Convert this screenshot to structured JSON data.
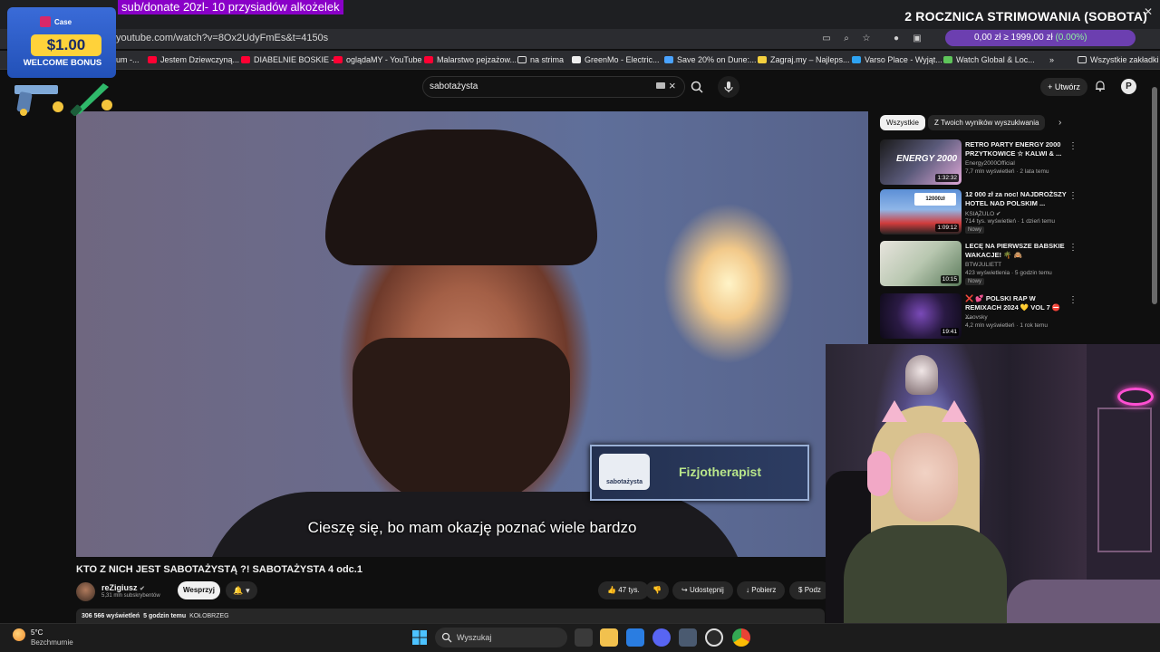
{
  "stream_overlay": {
    "top_banner": "sub/donate 20zl- 10 przysiadów alkożelek",
    "title": "2 ROCZNICA STRIMOWANIA (SOBOTA)"
  },
  "casino_ad": {
    "brand": "Case",
    "amount": "$1.00",
    "bonus": "WELCOME BONUS"
  },
  "browser": {
    "url": "youtube.com/watch?v=8Ox2UdyFmEs&t=4150s",
    "crypto": {
      "value": "0,00 zł",
      "sep": "≥",
      "target": "1999,00 zł",
      "pct": "(0.00%)"
    },
    "bookmarks": [
      {
        "label": "um -..."
      },
      {
        "label": "Jestem Dziewczyną..."
      },
      {
        "label": "DIABELNIE BOSKIE -..."
      },
      {
        "label": "oglądaMY - YouTube"
      },
      {
        "label": "Malarstwo pejzażow..."
      },
      {
        "label": "na strima"
      },
      {
        "label": "GreenMo - Electric..."
      },
      {
        "label": "Save 20% on Dune:..."
      },
      {
        "label": "Zagraj.my – Najleps..."
      },
      {
        "label": "Varso Place - Wyjąt..."
      },
      {
        "label": "Watch Global & Loc..."
      }
    ],
    "all_bookmarks": "Wszystkie zakładki"
  },
  "youtube": {
    "search_query": "sabotażysta",
    "create_label": "Utwórz",
    "video": {
      "subtitle": "Cieszę się, bo mam okazję poznać wiele bardzo",
      "lower_third_logo": "sabotażysta",
      "lower_third_name": "Fizjotherapist",
      "title": "KTO Z NICH JEST SABOTAŻYSTĄ ?! SABOTAŻYSTA 4 odc.1",
      "channel": "reZigiusz",
      "subscribers": "5,31 mln subskrybentów",
      "support_label": "Wesprzyj",
      "likes": "47 tys.",
      "share_label": "Udostępnij",
      "download_label": "Pobierz",
      "more_label": "Podz",
      "views": "306 566 wyświetleń",
      "time": "5 godzin temu",
      "location": "KOŁOBRZEG"
    },
    "chips": [
      "Wszystkie",
      "Z Twoich wyników wyszukiwania"
    ],
    "recommendations": [
      {
        "title": "RETRO PARTY ENERGY 2000 PRZYTKOWICE ☆ KALWI & ...",
        "channel": "Energy2000Official",
        "meta": "7,7 mln wyświetleń · 2 lata temu",
        "duration": "1:32:32",
        "badge": ""
      },
      {
        "title": "12 000 zł za noc! NAJDROŻSZY HOTEL NAD POLSKIM ...",
        "channel": "KSIĄŻULO ✔",
        "meta": "714 tys. wyświetleń · 1 dzień temu",
        "duration": "1:09:12",
        "badge": "Nowy"
      },
      {
        "title": "LECĘ NA PIERWSZE BABSKIE WAKACJE! 🌴 🙈",
        "channel": "BTWJULIETT",
        "meta": "423 wyświetlenia · 5 godzin temu",
        "duration": "10:15",
        "badge": "Nowy"
      },
      {
        "title": "❌ 💕 POLSKI RAP W REMIXACH 2024 💛 VOL 7 ⛔ ...",
        "channel": "Xaovsky",
        "meta": "4,2 mln wyświetleń · 1 rok temu",
        "duration": "19:41",
        "badge": ""
      }
    ]
  },
  "taskbar": {
    "temperature": "5°C",
    "weather": "Bezchmurnie",
    "search_placeholder": "Wyszukaj"
  }
}
